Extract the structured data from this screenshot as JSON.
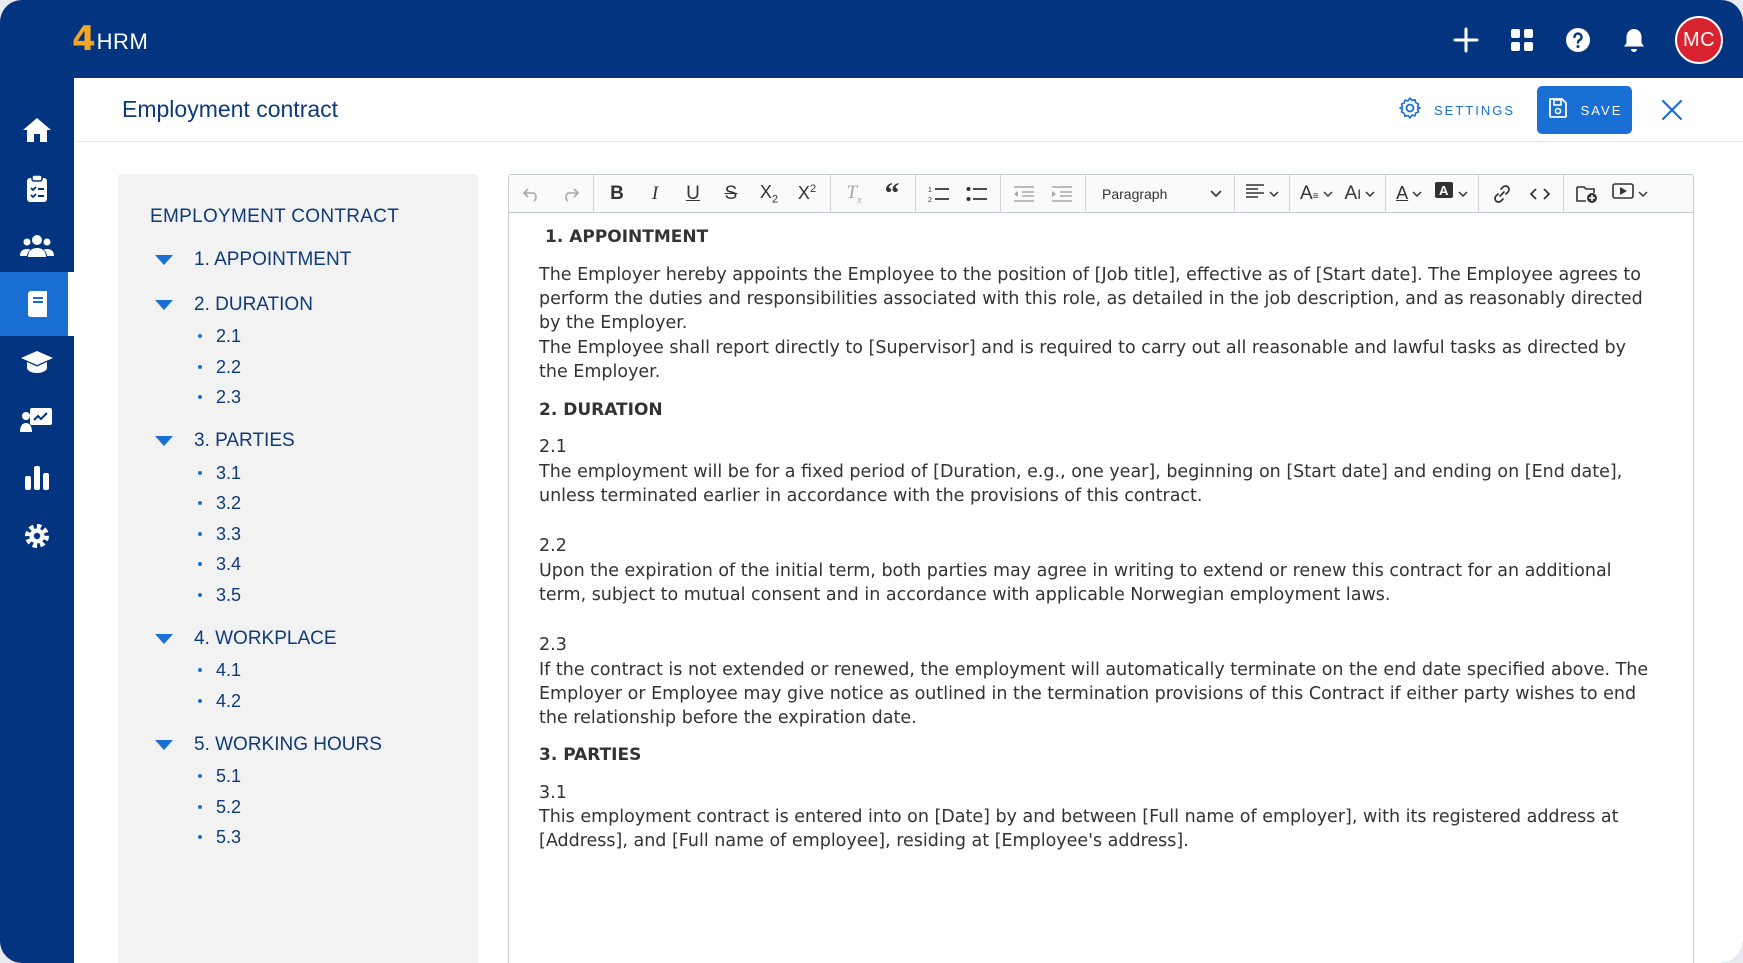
{
  "app": {
    "logo_number": "4",
    "logo_text": "HRM",
    "avatar_initials": "MC"
  },
  "colors": {
    "brand": "#03347f",
    "accent": "#1a6fd4",
    "avatar": "#d8232f",
    "logo_number": "#f5a623"
  },
  "topbar": {
    "icons": [
      "plus-icon",
      "apps-grid-icon",
      "help-icon",
      "bell-icon"
    ]
  },
  "nav": {
    "items": [
      "home-icon",
      "clipboard-icon",
      "people-icon",
      "book-icon",
      "graduation-cap-icon",
      "presentation-icon",
      "bar-chart-icon",
      "gear-icon"
    ],
    "active": "book-icon"
  },
  "header": {
    "title": "Employment contract",
    "settings_label": "SETTINGS",
    "save_label": "SAVE"
  },
  "outline": {
    "title": "EMPLOYMENT CONTRACT",
    "sections": [
      {
        "label": "1. APPOINTMENT",
        "subs": []
      },
      {
        "label": "2. DURATION",
        "subs": [
          "2.1",
          "2.2",
          "2.3"
        ]
      },
      {
        "label": "3. PARTIES",
        "subs": [
          "3.1",
          "3.2",
          "3.3",
          "3.4",
          "3.5"
        ]
      },
      {
        "label": "4. WORKPLACE",
        "subs": [
          "4.1",
          "4.2"
        ]
      },
      {
        "label": "5. WORKING HOURS",
        "subs": [
          "5.1",
          "5.2",
          "5.3"
        ]
      }
    ]
  },
  "toolbar": {
    "paragraph_style": "Paragraph"
  },
  "document": {
    "h1": "1. APPOINTMENT",
    "p1": "The Employer hereby appoints the Employee to the position of [Job title], effective as of [Start date]. The Employee agrees to perform the duties and responsibilities associated with this role, as detailed in the job description, and as reasonably directed by the Employer.",
    "p2": "The Employee shall report directly to [Supervisor] and is required to carry out all reasonable and lawful tasks as directed by the Employer.",
    "h2": "2. DURATION",
    "n21": "2.1",
    "p21": "The employment will be for a fixed period of [Duration, e.g., one year], beginning on [Start date] and ending on [End date], unless terminated earlier in accordance with the provisions of this contract.",
    "n22": "2.2",
    "p22": "Upon the expiration of the initial term, both parties may agree in writing to extend or renew this contract for an additional term, subject to mutual consent and in accordance with applicable Norwegian employment laws.",
    "n23": "2.3",
    "p23": "If the contract is not extended or renewed, the employment will automatically terminate on the end date specified above. The Employer or Employee may give notice as outlined in the termination provisions of this Contract if either party wishes to end the relationship before the expiration date.",
    "h3": "3. PARTIES",
    "n31": "3.1",
    "p31": "This employment contract is entered into on [Date] by and between [Full name of employer], with its registered address at [Address], and [Full name of employee], residing at [Employee's address]."
  }
}
